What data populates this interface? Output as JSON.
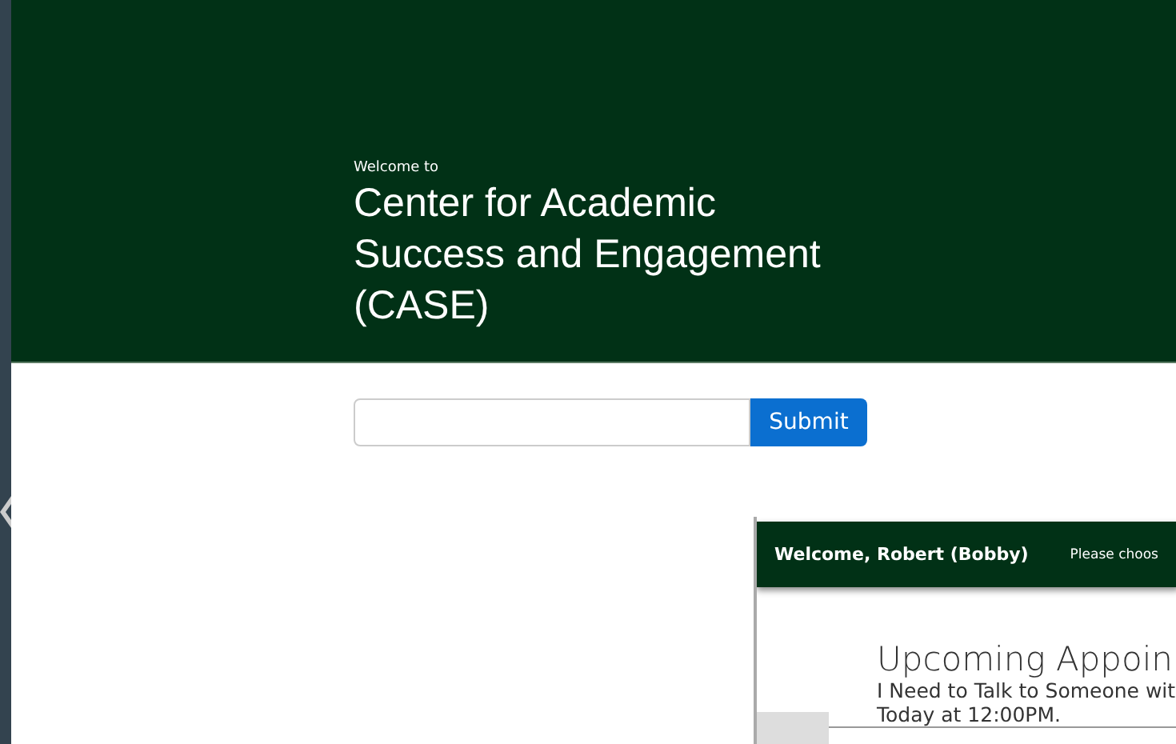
{
  "header": {
    "eyebrow": "Welcome to",
    "title_lines": [
      "Center for Academic",
      "Success and Engagement",
      "(CASE)"
    ]
  },
  "form": {
    "button": "Submit"
  },
  "preview": {
    "greeting": "Welcome, Robert (Bobby)",
    "prompt": "Please choos",
    "heading": "Upcoming Appoin",
    "lines": [
      "I Need to Talk to Someone wit",
      "Today at 12:00PM."
    ]
  }
}
